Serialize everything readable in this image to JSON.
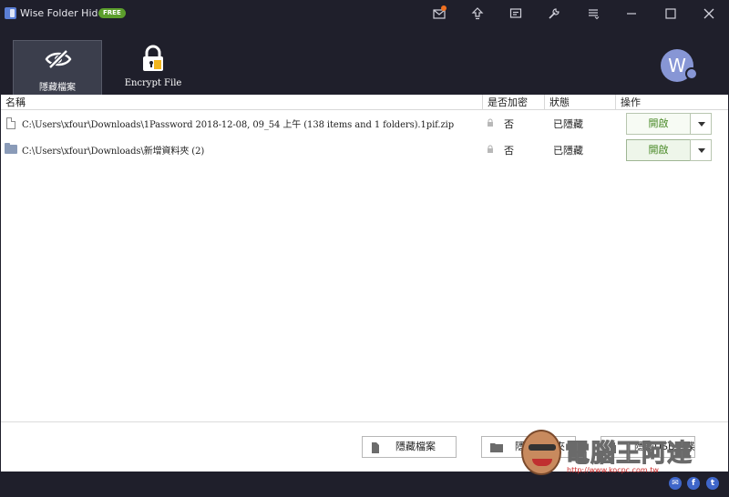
{
  "app": {
    "title": "Wise Folder Hider",
    "badge": "FREE"
  },
  "titlebar_icons": [
    "mail-icon",
    "upgrade-icon",
    "feedback-icon",
    "settings-icon",
    "menu-icon",
    "minimize-icon",
    "maximize-icon",
    "close-icon"
  ],
  "tabs": [
    {
      "label": "隱藏檔案",
      "icon": "hidden-eye-icon",
      "active": true
    },
    {
      "label": "Encrypt File",
      "icon": "lock-icon",
      "active": false
    }
  ],
  "avatar": {
    "initial": "W"
  },
  "table": {
    "columns": [
      "名稱",
      "是否加密",
      "狀態",
      "操作"
    ],
    "rows": [
      {
        "type": "file",
        "path": "C:\\Users\\xfour\\Downloads\\1Password 2018-12-08, 09_54 上午 (138 items and 1 folders).1pif.zip",
        "encrypted": "否",
        "status": "已隱藏",
        "action": "開啟"
      },
      {
        "type": "folder",
        "path": "C:\\Users\\xfour\\Downloads\\新增資料夾 (2)",
        "encrypted": "否",
        "status": "已隱藏",
        "action": "開啟"
      }
    ]
  },
  "footer_buttons": [
    {
      "label": "隱藏檔案",
      "icon": "file-icon"
    },
    {
      "label": "隱藏資料夾",
      "icon": "folder-icon"
    },
    {
      "label": "隱藏USB磁碟",
      "icon": "usb-icon"
    }
  ],
  "watermark": {
    "title": "電腦王阿達",
    "url": "http://www.kocpc.com.tw"
  },
  "social": [
    "email-icon",
    "facebook-icon",
    "twitter-icon"
  ],
  "colors": {
    "chrome": "#1f1f2b",
    "free_badge": "#5c9e2c",
    "open_text": "#4a8a28",
    "avatar": "#8796d5"
  }
}
